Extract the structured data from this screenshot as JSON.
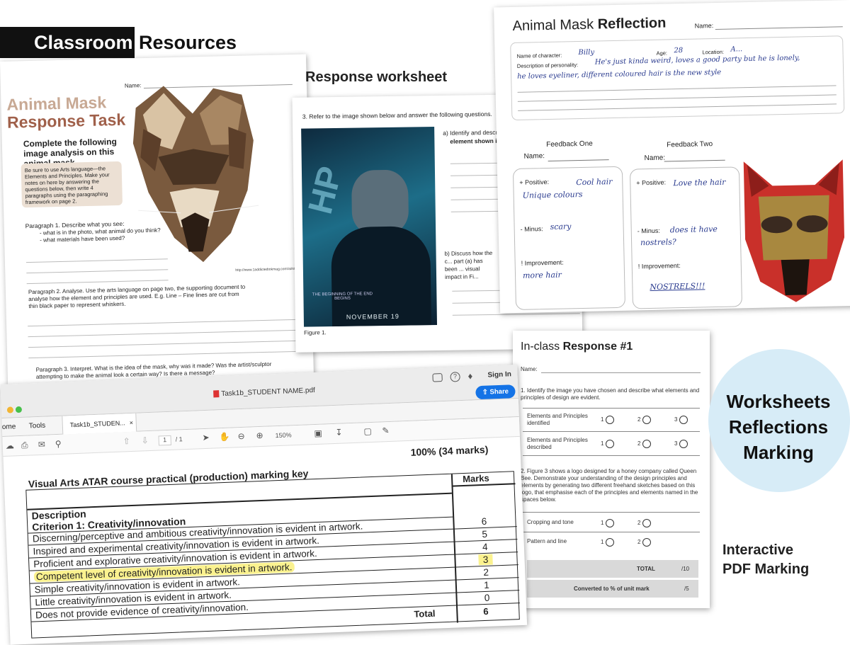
{
  "banner": {
    "part1": "Classroom",
    "part2": "Resources"
  },
  "task": {
    "name_label": "Name:",
    "title_line1": "Animal Mask",
    "title_line2": "Response Task",
    "subtitle": "Complete the following image analysis on this animal mask",
    "note": "Be sure to use Arts language—the Elements and Principles. Make your notes on here by answering the questions below, then write 4 paragraphs using the paragraphing framework on page 2.",
    "p1_title": "Paragraph 1. Describe what you see:",
    "p1_b1": "- what is in the photo, what animal do you think?",
    "p1_b2": "- what materials have been used?",
    "credit": "http://www.1addictedtokmag.com/ai/styling/DDS_JaguarMask_straight_bg.col_FINAL_NEW.jpg",
    "p2_text": "Paragraph 2. Analyse. Use the arts language on page two, the supporting document to analyse how the element and principles are used. E.g. Line – Fine lines are cut from thin black paper to represent whiskers.",
    "p3_text": "Paragraph 3. Interpret. What is the idea of the mask, why was it made? Was the artist/sculptor attempting to make the animal look a certain way? Is there a message?"
  },
  "resp": {
    "heading": "Response worksheet",
    "q3": "3. Refer to the image shown below and answer the following questions.",
    "qa": "a) Identify and describ...",
    "qa2": "element shown in",
    "qb": "b) Discuss how the c... part (a) has been ... visual impact in Fi...",
    "poster_date": "NOVEMBER 19",
    "poster_tag": "THE BEGINNING OF THE END BEGINS",
    "figure": "Figure 1."
  },
  "refl": {
    "title_light": "Animal Mask",
    "title_bold": "Reflection",
    "name_label": "Name:",
    "char_label": "Name of character:",
    "char_val": "Billy",
    "age_label": "Age:",
    "age_val": "28",
    "loc_label": "Location:",
    "loc_val": "A...",
    "desc_label": "Description of personality:",
    "desc_val1": "He's just kinda weird, loves a good party but he is lonely,",
    "desc_val2": "he loves eyeliner, different coloured hair is the new style",
    "fb1_title": "Feedback One",
    "fb2_title": "Feedback Two",
    "fb_name": "Name:",
    "pos_label": "+ Positive:",
    "minus_label": "- Minus:",
    "imp_label": "! Improvement:",
    "fb1_pos": "Cool hair Unique colours",
    "fb1_minus": "scary",
    "fb1_imp": "more hair",
    "fb2_pos": "Love the hair",
    "fb2_minus": "does it have nostrels?",
    "fb2_imp": "NOSTRELS!!!"
  },
  "inclass": {
    "title_light": "In-class",
    "title_bold": "Response #1",
    "name_label": "Name:",
    "q1": "1. Identify the image you have chosen and describe what elements and principles of design are evident.",
    "row1": "Elements and Principles identified",
    "row2": "Elements and Principles described",
    "q2": "2. Figure 3 shows a logo designed for a honey company called Queen Bee. Demonstrate your understanding of the design principles and elements by generating two different freehand sketches based on this logo, that emphasise each of the principles and elements named in the spaces below.",
    "row3": "Cropping and tone",
    "row4": "Pattern and line",
    "opt1": "1",
    "opt2": "2",
    "opt3": "3",
    "total_label": "TOTAL",
    "total_val": "/10",
    "conv_label": "Converted to % of unit mark",
    "conv_val": "/5"
  },
  "viewer": {
    "filename": "Task1b_STUDENT NAME.pdf",
    "signin": "Sign In",
    "share": "Share",
    "tab_home": "ome",
    "tab_tools": "Tools",
    "tab_doc": "Task1b_STUDEN...",
    "page_num": "1",
    "page_total": "/ 1",
    "zoom": "150%",
    "percent": "100% (34 marks)",
    "key_title": "Visual Arts ATAR course practical (production) marking key",
    "col_desc": "Description",
    "col_marks": "Marks",
    "criterion": "Criterion 1: Creativity/innovation",
    "rows": [
      {
        "desc": "Discerning/perceptive and ambitious creativity/innovation is evident in artwork.",
        "mark": "6"
      },
      {
        "desc": "Inspired and experimental creativity/innovation is evident in artwork.",
        "mark": "5"
      },
      {
        "desc": "Proficient and explorative creativity/innovation is evident in artwork.",
        "mark": "4"
      },
      {
        "desc": "Competent level of creativity/innovation is evident in artwork.",
        "mark": "3"
      },
      {
        "desc": "Simple creativity/innovation is evident in artwork.",
        "mark": "2"
      },
      {
        "desc": "Little creativity/innovation is evident in artwork.",
        "mark": "1"
      },
      {
        "desc": "Does not provide evidence of creativity/innovation.",
        "mark": "0"
      }
    ],
    "total_label": "Total",
    "total_val": "6"
  },
  "callouts": {
    "c1": "Worksheets",
    "c2": "Reflections",
    "c3": "Marking",
    "interactive1": "Interactive",
    "interactive2": "PDF Marking"
  }
}
